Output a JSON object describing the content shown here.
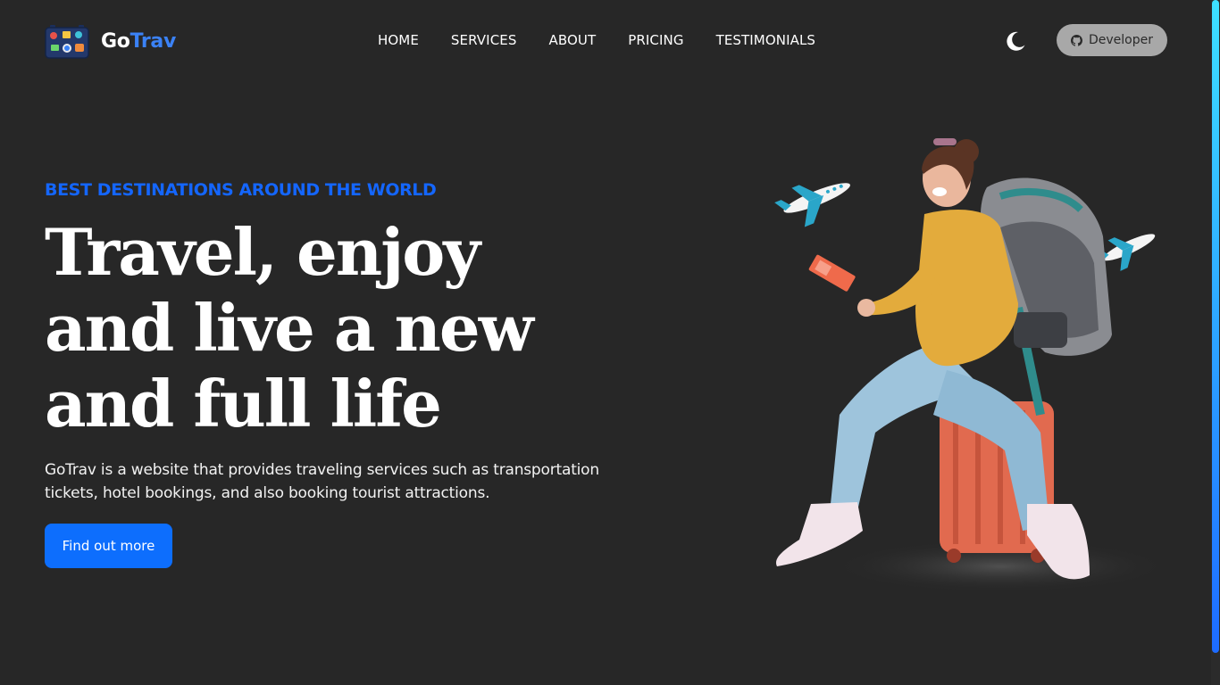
{
  "brand": {
    "name_part1": "Go",
    "name_part2": "Trav",
    "logo_icon": "suitcase-stickers-icon"
  },
  "nav": {
    "items": [
      {
        "label": "HOME"
      },
      {
        "label": "SERVICES"
      },
      {
        "label": "ABOUT"
      },
      {
        "label": "PRICING"
      },
      {
        "label": "TESTIMONIALS"
      }
    ]
  },
  "header": {
    "theme_toggle_icon": "moon-icon",
    "developer_button": {
      "label": "Developer",
      "icon": "github-icon"
    }
  },
  "hero": {
    "eyebrow": "BEST DESTINATIONS AROUND THE WORLD",
    "title_line1": "Travel, enjoy",
    "title_line2": "and live a new",
    "title_line3": "and full life",
    "description": "GoTrav is a website that provides traveling services such as transportation tickets, hotel bookings, and also booking tourist attractions.",
    "cta_label": "Find out more",
    "illustration": "traveler-on-suitcase-with-airplanes"
  },
  "colors": {
    "background": "#272727",
    "accent": "#1466ff",
    "button": "#0d6efd",
    "developer_button": "#a8a8a8"
  }
}
